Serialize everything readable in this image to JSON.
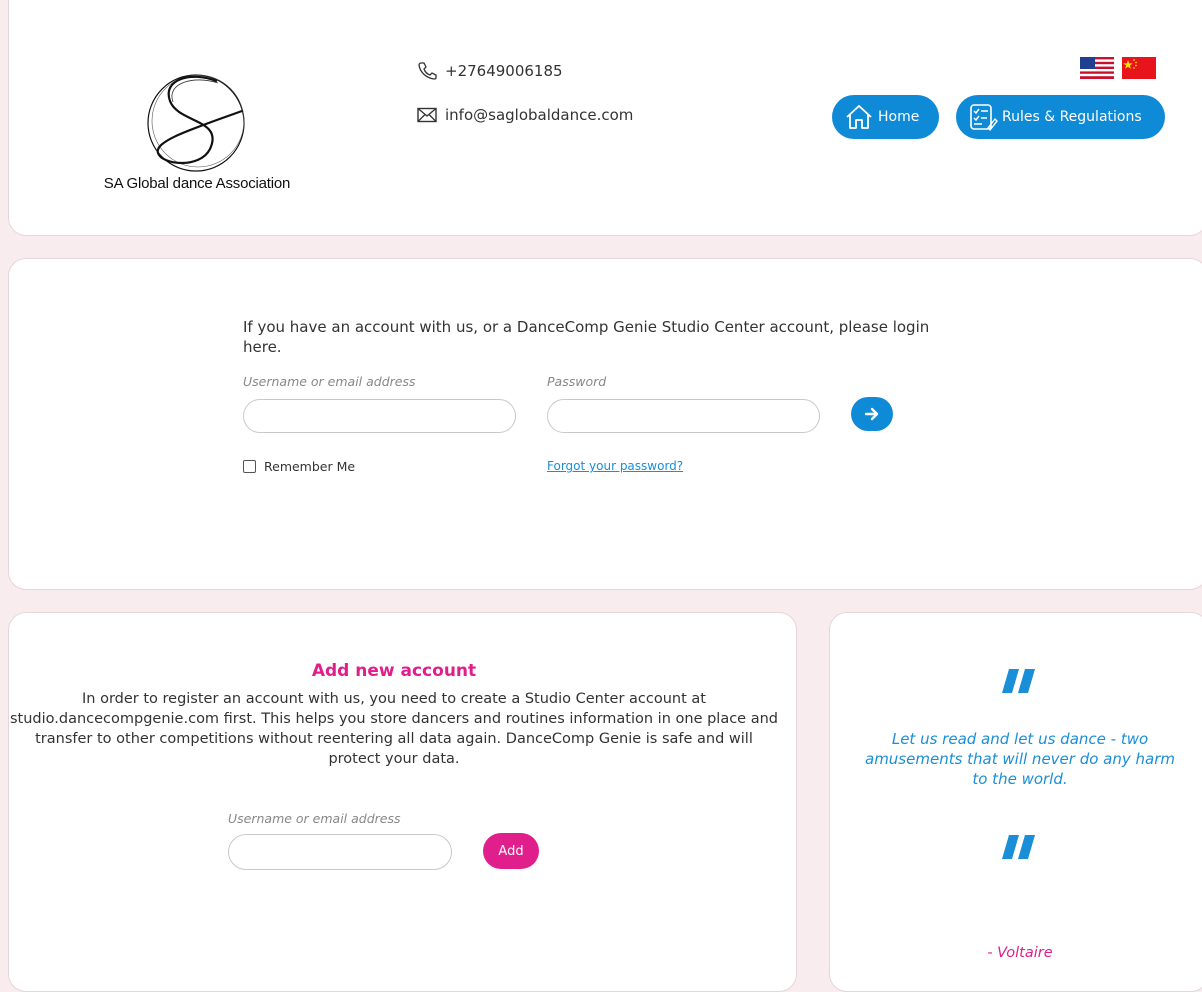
{
  "header": {
    "logo_text": "SA Global dance Association",
    "phone": "+27649006185",
    "email": "info@saglobaldance.com",
    "nav": {
      "home_label": "Home",
      "rules_label": "Rules & Regulations"
    },
    "flags": [
      "us-flag-icon",
      "china-flag-icon"
    ]
  },
  "login": {
    "intro": "If you have an account with us, or a DanceComp Genie Studio Center account, please login here.",
    "username_label": "Username or email address",
    "username_value": "",
    "password_label": "Password",
    "password_value": "",
    "remember_label": "Remember Me",
    "forgot_label": "Forgot your password?"
  },
  "add_account": {
    "title": "Add new account",
    "description": "In order to register an account with us, you need to create a Studio Center account at studio.dancecompgenie.com first. This helps you store dancers and routines information in one place and transfer to other competitions without reentering all data again. DanceComp Genie is safe and will protect your data.",
    "username_label": "Username or email address",
    "username_value": "",
    "add_label": "Add"
  },
  "quote": {
    "text": "Let us read and let us dance - two amusements that will never do any harm to the world.",
    "author": "- Voltaire"
  },
  "colors": {
    "primary_blue": "#0f8ad6",
    "accent_pink": "#e01e8c",
    "background": "#f9ecef"
  }
}
